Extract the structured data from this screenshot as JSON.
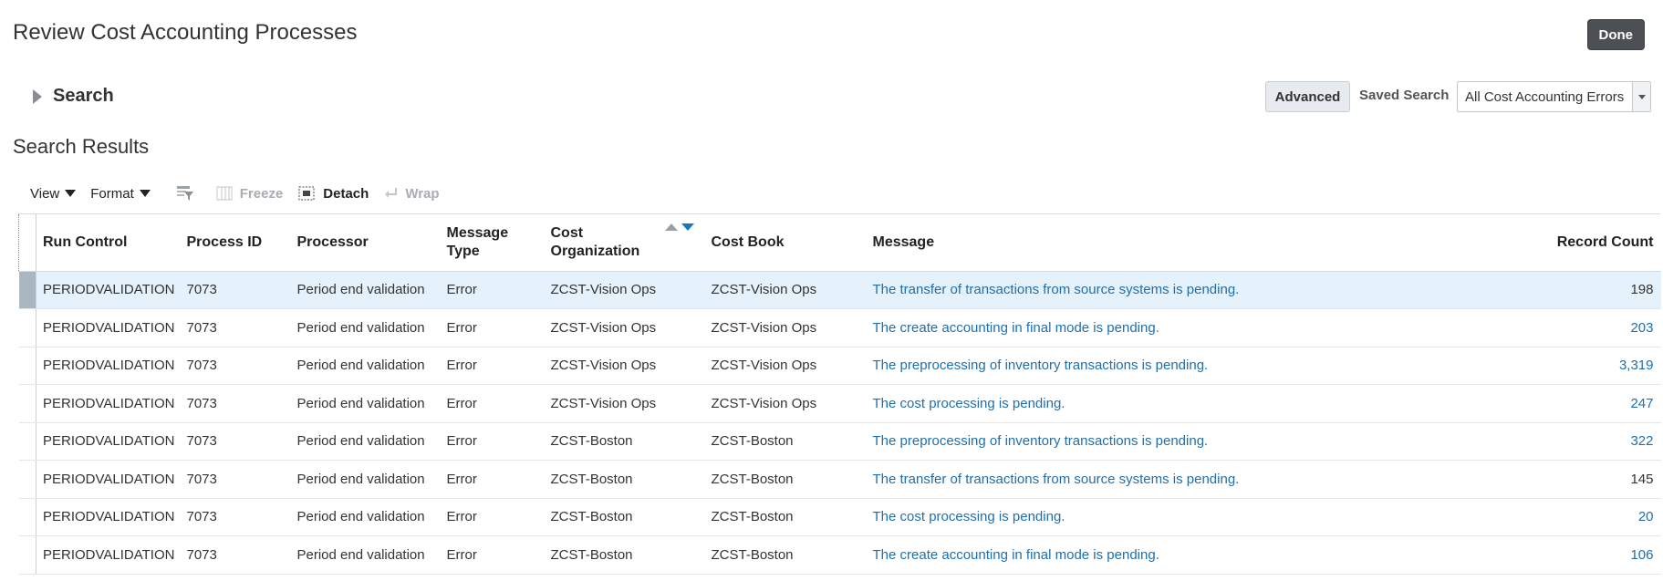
{
  "page": {
    "title": "Review Cost Accounting Processes",
    "done_label": "Done"
  },
  "search": {
    "label": "Search",
    "advanced_label": "Advanced",
    "saved_search_label": "Saved Search",
    "saved_search_value": "All Cost Accounting Errors"
  },
  "results": {
    "title": "Search Results",
    "toolbar": {
      "view_label": "View",
      "format_label": "Format",
      "freeze_label": "Freeze",
      "detach_label": "Detach",
      "wrap_label": "Wrap"
    },
    "columns": {
      "run_control": "Run Control",
      "process_id": "Process ID",
      "processor": "Processor",
      "message_type_line1": "Message",
      "message_type_line2": "Type",
      "cost_org_line1": "Cost",
      "cost_org_line2": "Organization",
      "cost_book": "Cost Book",
      "message": "Message",
      "record_count": "Record Count"
    },
    "rows": [
      {
        "run_control": "PERIODVALIDATION",
        "process_id": "7073",
        "processor": "Period end validation",
        "message_type": "Error",
        "cost_org": "ZCST-Vision Ops",
        "cost_book": "ZCST-Vision Ops",
        "message": "The transfer of transactions from source systems is pending.",
        "record_count": "198"
      },
      {
        "run_control": "PERIODVALIDATION",
        "process_id": "7073",
        "processor": "Period end validation",
        "message_type": "Error",
        "cost_org": "ZCST-Vision Ops",
        "cost_book": "ZCST-Vision Ops",
        "message": "The create accounting in final mode is pending.",
        "record_count": "203"
      },
      {
        "run_control": "PERIODVALIDATION",
        "process_id": "7073",
        "processor": "Period end validation",
        "message_type": "Error",
        "cost_org": "ZCST-Vision Ops",
        "cost_book": "ZCST-Vision Ops",
        "message": "The preprocessing of inventory transactions is pending.",
        "record_count": "3,319"
      },
      {
        "run_control": "PERIODVALIDATION",
        "process_id": "7073",
        "processor": "Period end validation",
        "message_type": "Error",
        "cost_org": "ZCST-Vision Ops",
        "cost_book": "ZCST-Vision Ops",
        "message": "The cost processing is pending.",
        "record_count": "247"
      },
      {
        "run_control": "PERIODVALIDATION",
        "process_id": "7073",
        "processor": "Period end validation",
        "message_type": "Error",
        "cost_org": "ZCST-Boston",
        "cost_book": "ZCST-Boston",
        "message": "The preprocessing of inventory transactions is pending.",
        "record_count": "322"
      },
      {
        "run_control": "PERIODVALIDATION",
        "process_id": "7073",
        "processor": "Period end validation",
        "message_type": "Error",
        "cost_org": "ZCST-Boston",
        "cost_book": "ZCST-Boston",
        "message": "The transfer of transactions from source systems is pending.",
        "record_count": "145"
      },
      {
        "run_control": "PERIODVALIDATION",
        "process_id": "7073",
        "processor": "Period end validation",
        "message_type": "Error",
        "cost_org": "ZCST-Boston",
        "cost_book": "ZCST-Boston",
        "message": "The cost processing is pending.",
        "record_count": "20"
      },
      {
        "run_control": "PERIODVALIDATION",
        "process_id": "7073",
        "processor": "Period end validation",
        "message_type": "Error",
        "cost_org": "ZCST-Boston",
        "cost_book": "ZCST-Boston",
        "message": "The create accounting in final mode is pending.",
        "record_count": "106"
      }
    ]
  },
  "colors": {
    "link": "#1f6fad",
    "selected_row": "#e5f1fb",
    "done_button": "#4c5054",
    "sort_active": "#1779c4"
  }
}
